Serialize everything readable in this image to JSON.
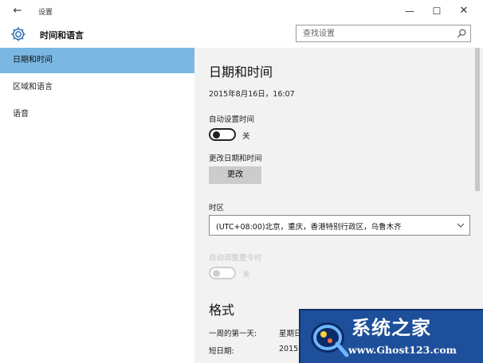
{
  "window": {
    "title": "设置",
    "back_glyph": "←",
    "min_glyph": "—",
    "max_glyph": "☐",
    "close_glyph": "✕"
  },
  "header": {
    "app_title": "时间和语言",
    "search_placeholder": "查找设置",
    "icons": [
      "gear-icon",
      "search-icon"
    ]
  },
  "sidebar": {
    "items": [
      {
        "label": "日期和时间",
        "selected": true
      },
      {
        "label": "区域和语言",
        "selected": false
      },
      {
        "label": "语音",
        "selected": false
      }
    ],
    "selected_color": "#7bb7e3"
  },
  "main": {
    "heading": "日期和时间",
    "current_datetime": "2015年8月16日，16:07",
    "auto_time": {
      "label": "自动设置时间",
      "state": "关",
      "on": false
    },
    "change_datetime": {
      "label": "更改日期和时间",
      "button": "更改"
    },
    "timezone": {
      "label": "时区",
      "value": "(UTC+08:00)北京，重庆，香港特别行政区，乌鲁木齐"
    },
    "auto_dst": {
      "label": "自动调整夏令时",
      "state": "关",
      "on": false,
      "enabled": false
    },
    "format": {
      "heading": "格式",
      "first_day": {
        "label": "一周的第一天:",
        "value": "星期日"
      },
      "short_date": {
        "label": "短日期:",
        "value": "2015"
      }
    }
  },
  "watermark": {
    "name": "系统之家",
    "url": "www.Ghost123.com"
  }
}
